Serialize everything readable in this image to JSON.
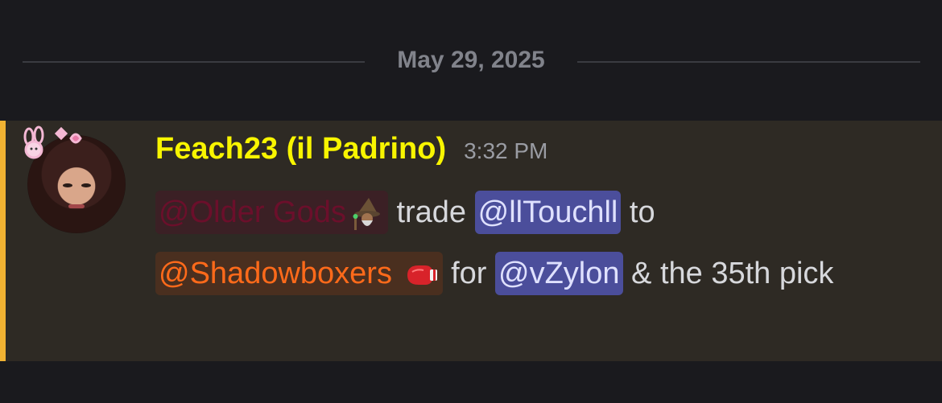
{
  "divider": {
    "date": "May 29, 2025"
  },
  "message": {
    "author": "Feach23 (il Padrino)",
    "timestamp": "3:32 PM",
    "mentions": {
      "older_gods": "@Older Gods",
      "touch": "@llTouchll",
      "shadowboxers": "@Shadowboxers",
      "zylon": "@vZylon"
    },
    "text": {
      "trade": " trade ",
      "to": " to",
      "for": " for ",
      "rest": " & the 35th pick"
    },
    "emojis": {
      "wizard": "mage-emoji",
      "boxing_glove": "boxing-glove-emoji"
    },
    "colors": {
      "accent_bar": "#f0b232",
      "username": "#f8f500",
      "role_older_gods": "#6b0f2b",
      "role_shadowboxers": "#ff6a1a",
      "user_mention_bg": "#4b4e9b"
    }
  }
}
